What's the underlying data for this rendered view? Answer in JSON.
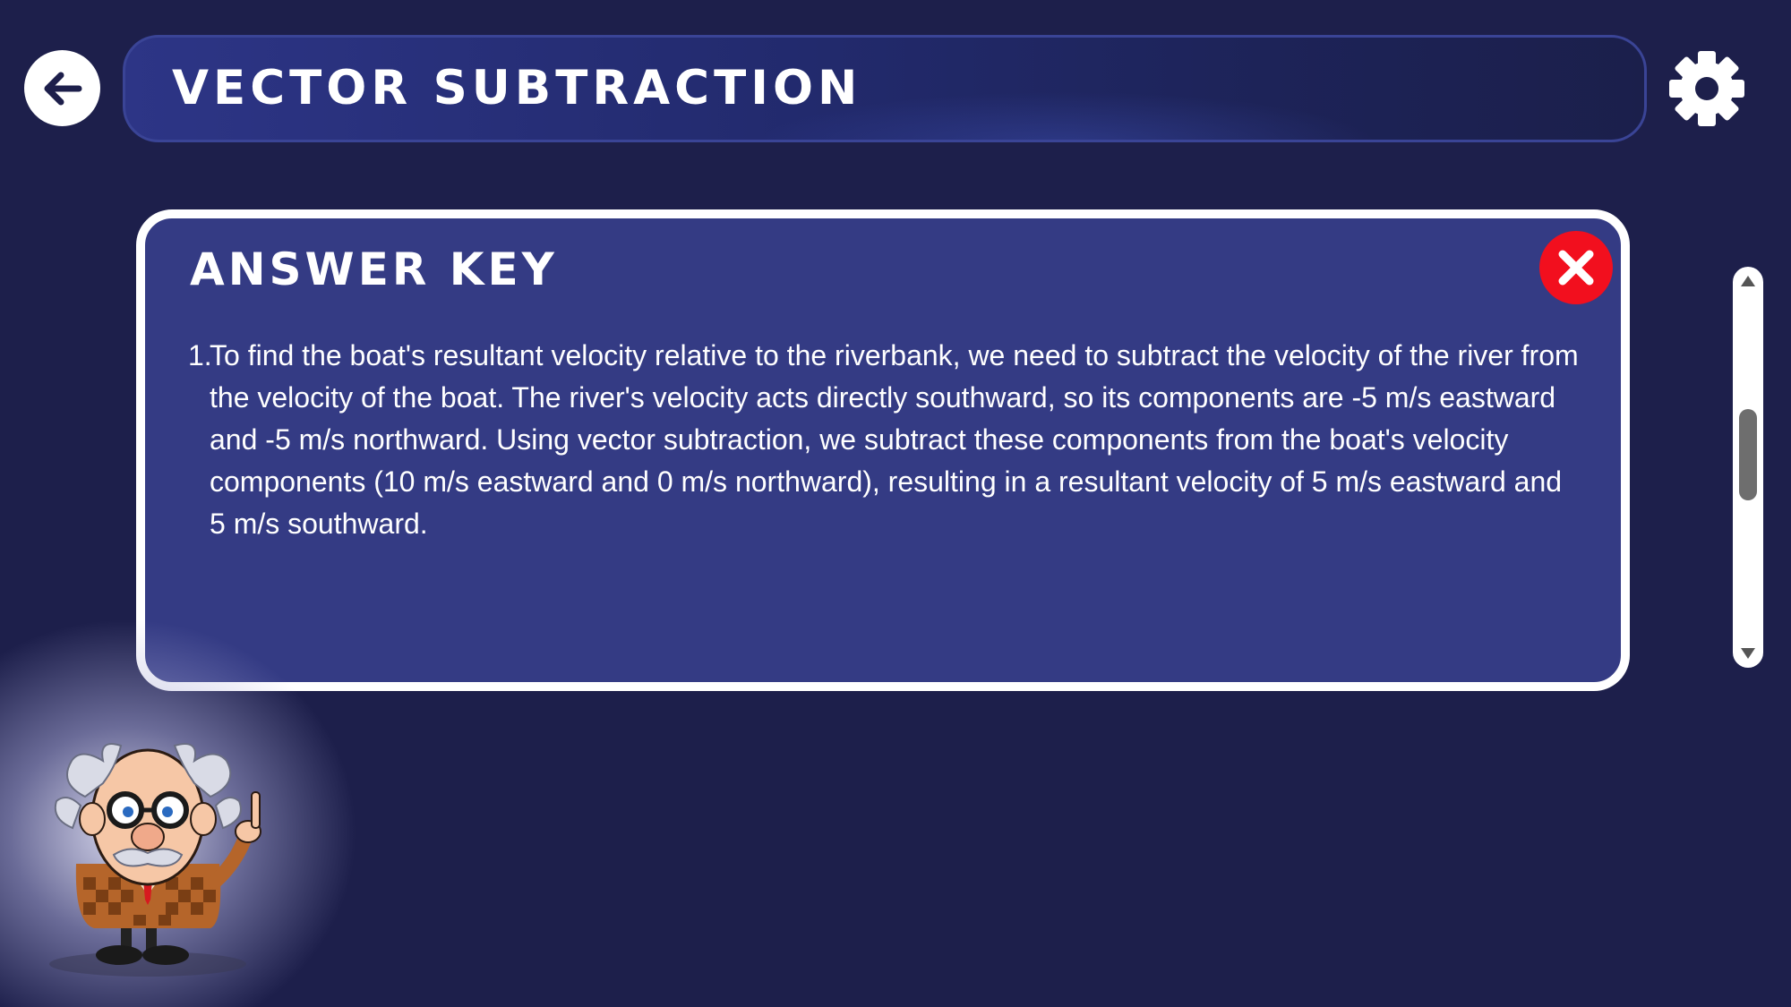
{
  "header": {
    "title": "VECTOR SUBTRACTION"
  },
  "answer_key": {
    "title": "ANSWER KEY",
    "items": [
      {
        "number": "1.",
        "text": "To find the boat's resultant velocity relative to the riverbank, we need to subtract the velocity of the river from the velocity of the boat. The river's velocity acts directly southward, so its components are -5 m/s eastward and -5 m/s northward. Using vector subtraction, we subtract these components from the boat's velocity components (10 m/s eastward and 0 m/s northward), resulting in a resultant velocity of 5 m/s eastward and 5 m/s southward."
      }
    ]
  },
  "scrollbar": {
    "position_fraction": 0.45
  },
  "icons": {
    "back": "arrow-left-icon",
    "settings": "gear-icon",
    "close": "close-icon",
    "mascot": "professor-mascot"
  },
  "colors": {
    "background": "#1d1f4b",
    "panel": "#343b84",
    "close": "#f20f1e",
    "text": "#ffffff"
  }
}
